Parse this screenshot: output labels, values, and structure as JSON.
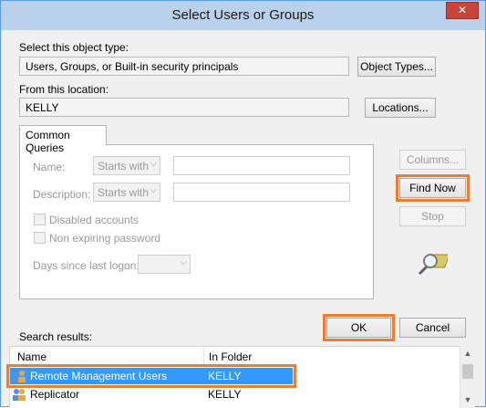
{
  "window": {
    "title": "Select Users or Groups",
    "close_glyph": "✕"
  },
  "object_type": {
    "label": "Select this object type:",
    "value": "Users, Groups, or Built-in security principals",
    "button": "Object Types..."
  },
  "location": {
    "label": "From this location:",
    "value": "KELLY",
    "button": "Locations..."
  },
  "common_queries": {
    "tab": "Common Queries",
    "name_label": "Name:",
    "name_mode": "Starts with",
    "description_label": "Description:",
    "description_mode": "Starts with",
    "disabled_accounts": "Disabled accounts",
    "non_expiring_password": "Non expiring password",
    "days_since_logon_label": "Days since last logon:"
  },
  "side_buttons": {
    "columns": "Columns...",
    "find_now": "Find Now",
    "stop": "Stop"
  },
  "footer": {
    "search_results_label": "Search results:",
    "ok": "OK",
    "cancel": "Cancel"
  },
  "results": {
    "columns": [
      "Name",
      "In Folder"
    ],
    "rows": [
      {
        "name": "Remote Management Users",
        "folder": "KELLY",
        "selected": true
      },
      {
        "name": "Replicator",
        "folder": "KELLY",
        "selected": false
      }
    ]
  },
  "colors": {
    "highlight": "#ed7d31",
    "selection": "#3399ff",
    "titlebar": "#b9d1ea"
  }
}
